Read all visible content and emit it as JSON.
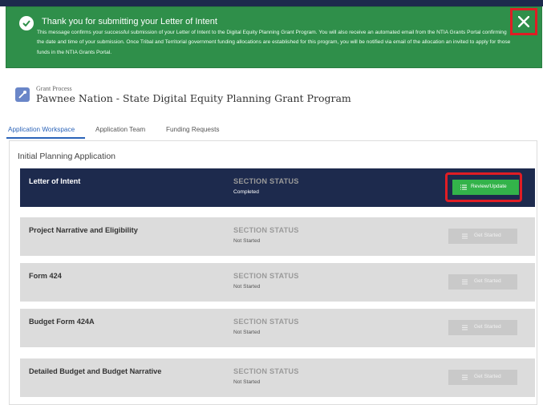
{
  "banner": {
    "title": "Thank you for submitting your Letter of Intent",
    "message": "This message confirms your successful submission of your Letter of Intent to the Digital Equity Planning Grant Program. You will also receive an automated email from the NTIA Grants Portal confirming the date and time of your submission. Once Tribal and Territorial government funding allocations are established for this program, you will be notified via email of the allocation an invited to apply for those funds in the NTIA Grants Portal.",
    "close_label": "✕"
  },
  "grant": {
    "kicker": "Grant Process",
    "title": "Pawnee Nation - State Digital Equity Planning Grant Program"
  },
  "tabs": [
    {
      "label": "Application Workspace",
      "active": true
    },
    {
      "label": "Application Team",
      "active": false
    },
    {
      "label": "Funding Requests",
      "active": false
    }
  ],
  "panel": {
    "title": "Initial Planning Application"
  },
  "sections": [
    {
      "name": "Letter of Intent",
      "status_label": "SECTION STATUS",
      "status_value": "Completed",
      "button_label": "Review/Update"
    },
    {
      "name": "Project Narrative and Eligibility",
      "status_label": "SECTION STATUS",
      "status_value": "Not Started",
      "button_label": "Get Started"
    },
    {
      "name": "Form 424",
      "status_label": "SECTION STATUS",
      "status_value": "Not Started",
      "button_label": "Get Started"
    },
    {
      "name": "Budget Form 424A",
      "status_label": "SECTION STATUS",
      "status_value": "Not Started",
      "button_label": "Get Started"
    },
    {
      "name": "Detailed Budget and Budget Narrative",
      "status_label": "SECTION STATUS",
      "status_value": "Not Started",
      "button_label": "Get Started"
    }
  ],
  "colors": {
    "banner_green": "#2f8f4a",
    "navy": "#1d2a4d",
    "highlight_red": "#e01d24",
    "button_green": "#33b34a",
    "tab_blue": "#2b63b8"
  }
}
